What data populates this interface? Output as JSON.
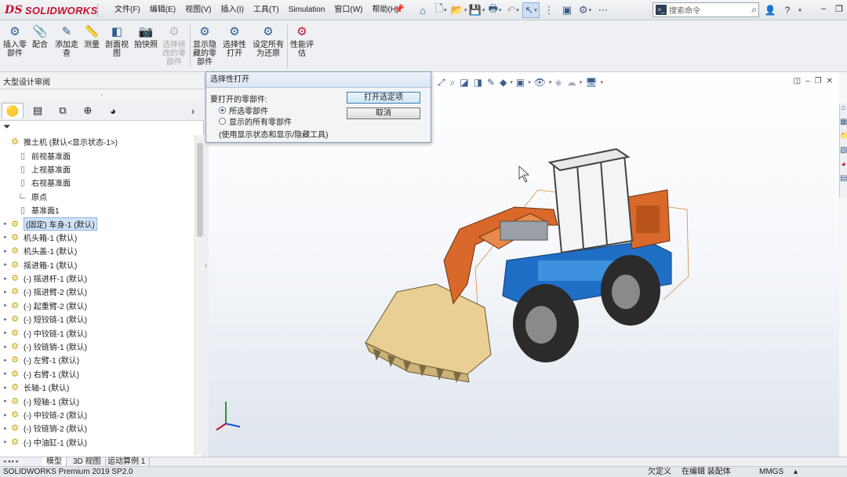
{
  "app": {
    "logo_text": "SOLIDWORKS",
    "logo_mark": "DS"
  },
  "menu": [
    "文件(F)",
    "编辑(E)",
    "视图(V)",
    "插入(I)",
    "工具(T)",
    "Simulation",
    "窗口(W)",
    "帮助(H)"
  ],
  "search": {
    "placeholder": "搜索命令"
  },
  "ribbon": {
    "insert_component": "插入零\n部件",
    "mate": "配合",
    "add_annotation": "添加走\n查",
    "measure": "测量",
    "section_view": "剖面视\n图",
    "snapshot": "拍快照",
    "modify_component": "选择修\n改的零\n部件",
    "show_hidden": "显示隐\n藏的零\n部件",
    "selective_open": "选择性\n打开",
    "set_all_restore": "设定所有\n为还原",
    "performance_eval": "性能评\n估"
  },
  "tabrow": {
    "label": "大型设计审阅"
  },
  "tree": {
    "items": [
      {
        "label": "推土机 (默认<显示状态-1>)",
        "icon": "assembly-icon",
        "indent": 0,
        "expander": "",
        "selected": false
      },
      {
        "label": "前视基准面",
        "icon": "plane-icon",
        "indent": 1,
        "expander": "",
        "selected": false
      },
      {
        "label": "上视基准面",
        "icon": "plane-icon",
        "indent": 1,
        "expander": "",
        "selected": false
      },
      {
        "label": "右视基准面",
        "icon": "plane-icon",
        "indent": 1,
        "expander": "",
        "selected": false
      },
      {
        "label": "原点",
        "icon": "origin-icon",
        "indent": 1,
        "expander": "",
        "selected": false
      },
      {
        "label": "基准面1",
        "icon": "plane-icon",
        "indent": 1,
        "expander": "",
        "selected": false
      },
      {
        "label": "(固定) 车身-1 (默认)",
        "icon": "part-icon",
        "indent": 0,
        "expander": "▸",
        "selected": true
      },
      {
        "label": "机头箱-1 (默认)",
        "icon": "part-icon",
        "indent": 0,
        "expander": "▸",
        "selected": false
      },
      {
        "label": "机头盖-1 (默认)",
        "icon": "part-icon",
        "indent": 0,
        "expander": "▸",
        "selected": false
      },
      {
        "label": "摇进箱-1 (默认)",
        "icon": "part-icon",
        "indent": 0,
        "expander": "▸",
        "selected": false
      },
      {
        "label": "(-) 摇进杆-1 (默认)",
        "icon": "part-icon",
        "indent": 0,
        "expander": "▸",
        "selected": false
      },
      {
        "label": "(-) 摇进臂-2 (默认)",
        "icon": "part-icon",
        "indent": 0,
        "expander": "▸",
        "selected": false
      },
      {
        "label": "(-) 起重臂-2 (默认)",
        "icon": "part-icon",
        "indent": 0,
        "expander": "▸",
        "selected": false
      },
      {
        "label": "(-) 短铰链-1 (默认)",
        "icon": "part-icon",
        "indent": 0,
        "expander": "▸",
        "selected": false
      },
      {
        "label": "(-) 中铰链-1 (默认)",
        "icon": "part-icon",
        "indent": 0,
        "expander": "▸",
        "selected": false
      },
      {
        "label": "(-) 铰链销-1 (默认)",
        "icon": "part-icon",
        "indent": 0,
        "expander": "▸",
        "selected": false
      },
      {
        "label": "(-) 左臂-1 (默认)",
        "icon": "part-icon",
        "indent": 0,
        "expander": "▸",
        "selected": false
      },
      {
        "label": "(-) 右臂-1 (默认)",
        "icon": "part-icon",
        "indent": 0,
        "expander": "▸",
        "selected": false
      },
      {
        "label": "长轴-1 (默认)",
        "icon": "part-icon",
        "indent": 0,
        "expander": "▸",
        "selected": false
      },
      {
        "label": "(-) 短轴-1 (默认)",
        "icon": "part-icon",
        "indent": 0,
        "expander": "▸",
        "selected": false
      },
      {
        "label": "(-) 中铰链-2 (默认)",
        "icon": "part-icon",
        "indent": 0,
        "expander": "▸",
        "selected": false
      },
      {
        "label": "(-) 铰链销-2 (默认)",
        "icon": "part-icon",
        "indent": 0,
        "expander": "▸",
        "selected": false
      },
      {
        "label": "(-) 中油缸-1 (默认)",
        "icon": "part-icon",
        "indent": 0,
        "expander": "▸",
        "selected": false
      }
    ]
  },
  "dialog": {
    "title": "选择性打开",
    "prompt": "要打开的零部件:",
    "option_selected": "所选零部件",
    "option_all_shown": "显示的所有零部件",
    "note": "(使用显示状态和显示/隐藏工具)",
    "open_button": "打开选定项",
    "cancel_button": "取消",
    "selected_option": "option_selected"
  },
  "bottom_tabs": [
    "模型",
    "3D 视图",
    "运动算例 1"
  ],
  "status": {
    "product": "SOLIDWORKS Premium 2019 SP2.0",
    "defined": "欠定义",
    "editing": "在编辑 装配体",
    "units": "MMGS"
  },
  "colors": {
    "loader_orange": "#d8692a",
    "loader_blue": "#1f6fc7",
    "bucket": "#e9cf94",
    "tire": "#2b2b2b",
    "brand_red": "#c8102e",
    "selection": "#cfe2f7"
  }
}
